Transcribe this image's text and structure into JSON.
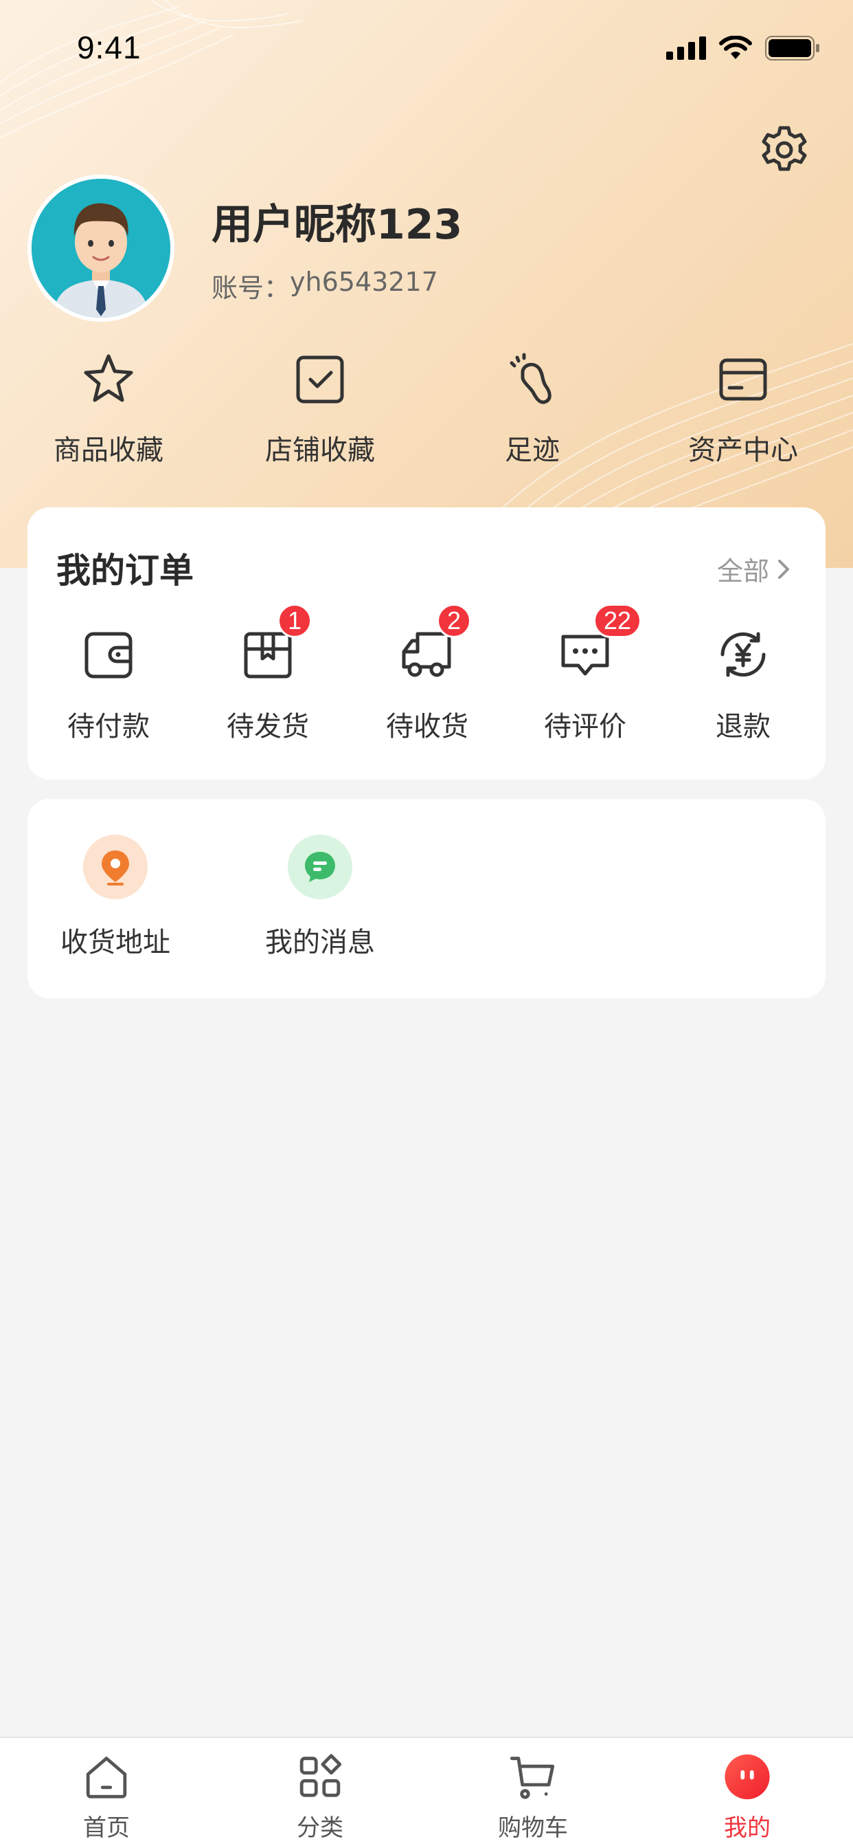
{
  "status_bar": {
    "time": "9:41"
  },
  "profile": {
    "nickname": "用户昵称123",
    "account_label": "账号：",
    "account_id": "yh6543217"
  },
  "quick_entries": [
    {
      "label": "商品收藏",
      "icon": "star-icon"
    },
    {
      "label": "店铺收藏",
      "icon": "checkbox-icon"
    },
    {
      "label": "足迹",
      "icon": "footprint-icon"
    },
    {
      "label": "资产中心",
      "icon": "wallet-card-icon"
    }
  ],
  "orders": {
    "title": "我的订单",
    "all_label": "全部",
    "items": [
      {
        "label": "待付款",
        "icon": "wallet-icon",
        "badge": ""
      },
      {
        "label": "待发货",
        "icon": "package-icon",
        "badge": "1"
      },
      {
        "label": "待收货",
        "icon": "truck-icon",
        "badge": "2"
      },
      {
        "label": "待评价",
        "icon": "comment-icon",
        "badge": "22"
      },
      {
        "label": "退款",
        "icon": "refund-yen-icon",
        "badge": ""
      }
    ]
  },
  "services": [
    {
      "label": "收货地址",
      "icon": "location-pin-icon",
      "color": "#f07d2e"
    },
    {
      "label": "我的消息",
      "icon": "message-bubble-icon",
      "color": "#3dbb6a"
    }
  ],
  "tabbar": {
    "active": "我的",
    "accent_color": "#f2343c",
    "tabs": [
      {
        "label": "首页",
        "icon": "home-icon"
      },
      {
        "label": "分类",
        "icon": "category-icon"
      },
      {
        "label": "购物车",
        "icon": "cart-icon"
      },
      {
        "label": "我的",
        "icon": "profile-face-icon"
      }
    ]
  }
}
